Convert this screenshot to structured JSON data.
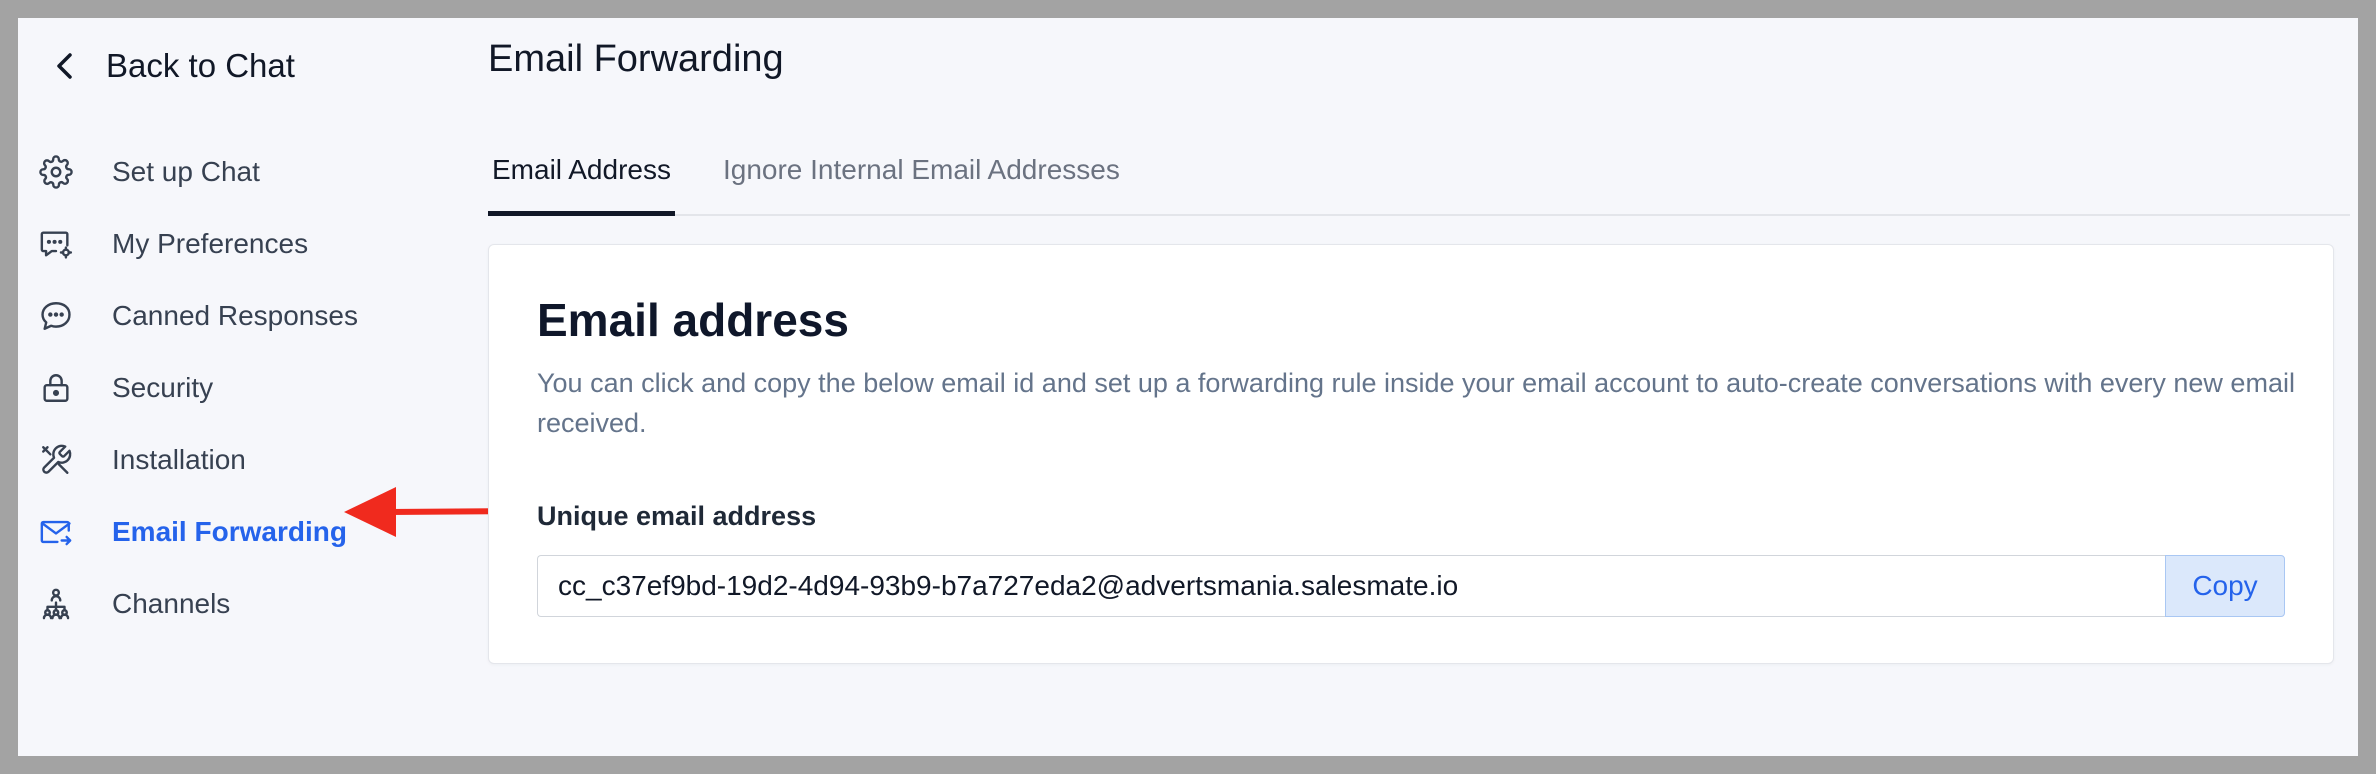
{
  "sidebar": {
    "back_label": "Back to Chat",
    "items": [
      {
        "label": "Set up Chat",
        "icon": "gear-icon"
      },
      {
        "label": "My Preferences",
        "icon": "chat-preferences-icon"
      },
      {
        "label": "Canned Responses",
        "icon": "speech-bubble-icon"
      },
      {
        "label": "Security",
        "icon": "lock-icon"
      },
      {
        "label": "Installation",
        "icon": "tools-icon"
      },
      {
        "label": "Email Forwarding",
        "icon": "mail-forward-icon",
        "active": true
      },
      {
        "label": "Channels",
        "icon": "channels-hierarchy-icon"
      }
    ]
  },
  "annotation": {
    "arrow_color": "#f02a1e",
    "points_to": "Email Forwarding"
  },
  "main": {
    "title": "Email Forwarding",
    "tabs": [
      {
        "label": "Email Address",
        "active": true
      },
      {
        "label": "Ignore Internal Email Addresses",
        "active": false
      }
    ],
    "card": {
      "title": "Email address",
      "description": "You can click and copy the below email id and set up a forwarding rule inside your email account to auto-create conversations with every new email received.",
      "field_label": "Unique email address",
      "email_value": "cc_c37ef9bd-19d2-4d94-93b9-b7a727eda2@advertsmania.salesmate.io",
      "copy_label": "Copy"
    }
  },
  "colors": {
    "accent": "#2563eb",
    "frame": "#a3a3a3",
    "background": "#f6f7fb"
  }
}
